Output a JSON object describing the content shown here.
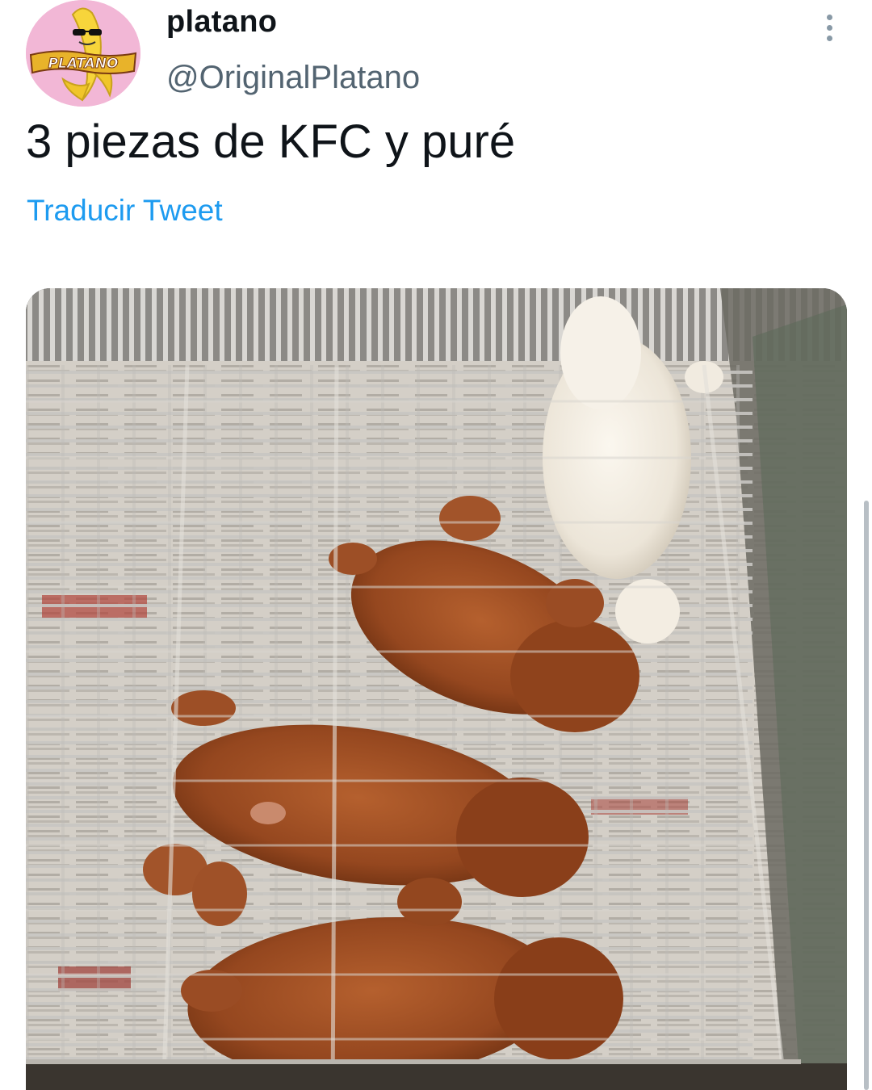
{
  "author": {
    "display_name": "platano",
    "handle": "@OriginalPlatano",
    "avatar_logo_text": "PLATANO",
    "avatar_bg": "#f2b7d6"
  },
  "tweet": {
    "text": "3 piezas de KFC y puré",
    "translate_label": "Traducir Tweet"
  },
  "menu": {
    "icon": "more-vertical-icon"
  },
  "colors": {
    "text_primary": "#0f1419",
    "text_secondary": "#536471",
    "link": "#1d9bf0"
  }
}
